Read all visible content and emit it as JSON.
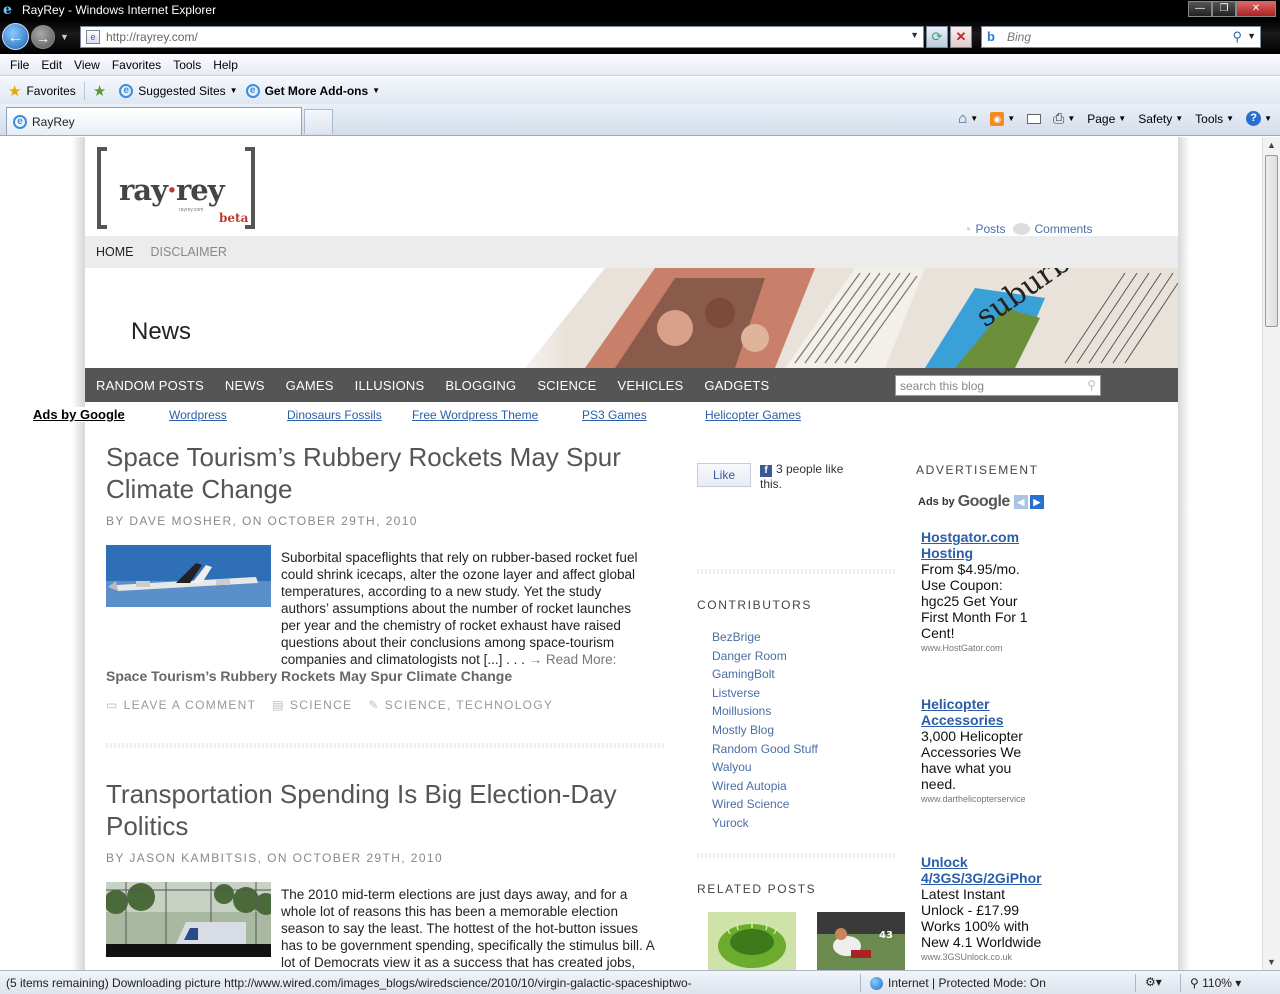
{
  "window": {
    "title": "RayRey - Windows Internet Explorer"
  },
  "address": {
    "url": "http://rayrey.com/",
    "search_placeholder": "Bing"
  },
  "menu": [
    "File",
    "Edit",
    "View",
    "Favorites",
    "Tools",
    "Help"
  ],
  "favorites_bar": {
    "favorites": "Favorites",
    "suggested": "Suggested Sites",
    "addons": "Get More Add-ons"
  },
  "tab": {
    "title": "RayRey"
  },
  "command_bar": {
    "page": "Page",
    "safety": "Safety",
    "tools": "Tools"
  },
  "site": {
    "logo_word_left": "ray",
    "logo_word_right": "rey",
    "logo_small": "rayrey.com",
    "logo_beta": "beta",
    "subscribe_posts": "Posts",
    "subscribe_comments": "Comments",
    "top_nav": [
      "HOME",
      "DISCLAIMER"
    ],
    "banner_title": "News",
    "cat_nav": [
      "RANDOM POSTS",
      "NEWS",
      "GAMES",
      "ILLUSIONS",
      "BLOGGING",
      "SCIENCE",
      "VEHICLES",
      "GADGETS"
    ],
    "search_placeholder": "search this blog",
    "ads_label": "Ads by Google",
    "ad_links": [
      "Wordpress",
      "Dinosaurs Fossils",
      "Free Wordpress Theme",
      "PS3 Games",
      "Helicopter Games"
    ]
  },
  "posts": [
    {
      "title_l1": "Space Tourism’s Rubbery Rockets May Spur",
      "title_l2": "Climate Change",
      "meta": "BY DAVE MOSHER, ON OCTOBER 29TH, 2010",
      "body": [
        "Suborbital spaceflights that rely on rubber-based rocket fuel",
        "could shrink icecaps, alter the ozone layer and affect global",
        "temperatures, according to a new study. Yet the study",
        "authors’ assumptions about the number of rocket launches",
        "per year and the chemistry of rocket exhaust have raised",
        "questions about their conclusions among space-tourism"
      ],
      "body_last": "companies and climatologists not [...] . . . ",
      "read_more": "→ Read More:",
      "read_more_title": "Space Tourism’s Rubbery Rockets May Spur Climate Change",
      "comment": "LEAVE A COMMENT",
      "category": "SCIENCE",
      "tags": "SCIENCE, TECHNOLOGY"
    },
    {
      "title_l1": "Transportation Spending Is Big Election-Day",
      "title_l2": "Politics",
      "meta": "BY JASON KAMBITSIS, ON OCTOBER 29TH, 2010",
      "body": [
        "The 2010 mid-term elections are just days away, and for a",
        "whole lot of reasons this has been a memorable election",
        "season to say the least. The hottest of the hot-button issues",
        "has to be government spending, specifically the stimulus bill. A",
        "lot of Democrats view it as a success that has created jobs,"
      ]
    }
  ],
  "sidebar": {
    "like_label": "Like",
    "like_text": "3 people like this.",
    "contributors_head": "CONTRIBUTORS",
    "contributors": [
      "BezBrige",
      "Danger Room",
      "GamingBolt",
      "Listverse",
      "Moillusions",
      "Mostly Blog",
      "Random Good Stuff",
      "Walyou",
      "Wired Autopia",
      "Wired Science",
      "Yurock"
    ],
    "related_head": "RELATED POSTS"
  },
  "ads": {
    "head": "ADVERTISEMENT",
    "adsby": "Ads by",
    "google": "Google",
    "items": [
      {
        "l1": "Hostgator.com",
        "l2": "Hosting",
        "text": [
          "From $4.95/mo.",
          "Use Coupon:",
          "hgc25 Get Your",
          "First Month For 1",
          "Cent!"
        ],
        "url": "www.HostGator.com"
      },
      {
        "l1": "Helicopter",
        "l2": "Accessories",
        "text": [
          "3,000 Helicopter",
          "Accessories We",
          "have what you",
          "need."
        ],
        "url": "www.darthelicopterservice"
      },
      {
        "l1": "Unlock",
        "l2": "4/3GS/3G/2GiPhor",
        "text": [
          "Latest Instant",
          "Unlock - £17.99",
          "Works 100% with",
          "New 4.1 Worldwide"
        ],
        "url": "www.3GSUnlock.co.uk"
      }
    ]
  },
  "status": {
    "text": "(5 items remaining) Downloading picture http://www.wired.com/images_blogs/wiredscience/2010/10/virgin-galactic-spaceshiptwo-",
    "zone": "Internet | Protected Mode: On",
    "zoom": "110%"
  },
  "colors": {
    "link": "#4a6fa5",
    "catnav_bg": "#555555",
    "ad_link": "#2a5ea8"
  }
}
